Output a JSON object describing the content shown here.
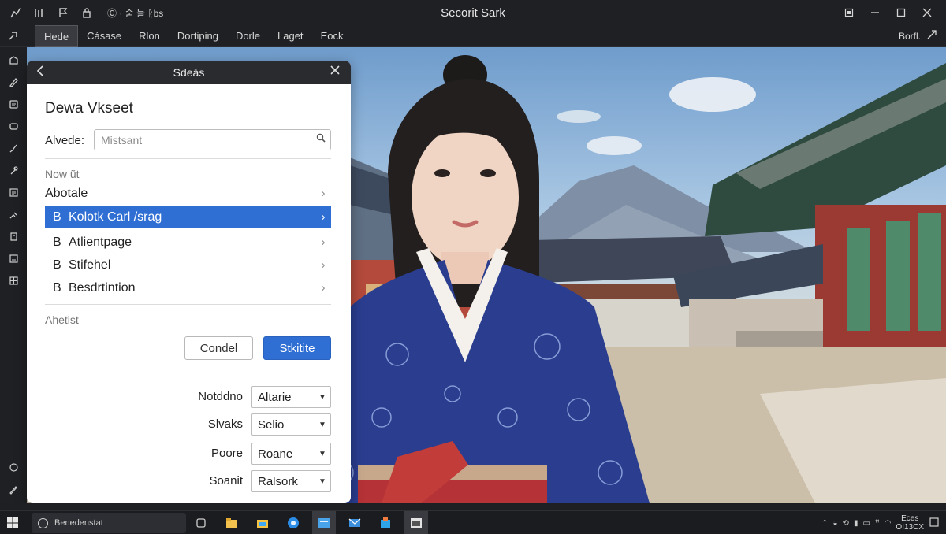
{
  "window": {
    "title": "Secorit Sark",
    "toolbar_text": "Ⓒ · 숟 들 ᚱbs",
    "controls": [
      "restore-small",
      "minimize",
      "maximize",
      "close"
    ]
  },
  "menubar": {
    "items": [
      {
        "label": "Hede",
        "active": true
      },
      {
        "label": "Cásase",
        "active": false
      },
      {
        "label": "Rlon",
        "active": false
      },
      {
        "label": "Dortiping",
        "active": false
      },
      {
        "label": "Dorle",
        "active": false
      },
      {
        "label": "Laget",
        "active": false
      },
      {
        "label": "Eock",
        "active": false
      }
    ],
    "right_label": "Borfl."
  },
  "panel": {
    "header_title": "Sdeăs",
    "title": "Dewa Vkseet",
    "search": {
      "label": "Alvede:",
      "placeholder": "Mistsant",
      "value": ""
    },
    "section1_label": "Now ũt",
    "list": [
      {
        "prefix": "",
        "label": "Abotale",
        "selected": false
      },
      {
        "prefix": "B",
        "label": "Kolotk Carl /srag",
        "selected": true
      },
      {
        "prefix": "B",
        "label": "Atlientpage",
        "selected": false
      },
      {
        "prefix": "B",
        "label": "Stifehel",
        "selected": false
      },
      {
        "prefix": "B",
        "label": "Besdrtintion",
        "selected": false
      }
    ],
    "section2_label": "Ahetist",
    "cancel_label": "Condel",
    "primary_label": "Stkitite",
    "fields": [
      {
        "label": "Notddno",
        "value": "Altarie"
      },
      {
        "label": "Slvaks",
        "value": "Selio"
      },
      {
        "label": "Poore",
        "value": "Roane"
      },
      {
        "label": "Soanit",
        "value": "Ralsork"
      }
    ]
  },
  "taskbar": {
    "search_text": "Benedenstat",
    "clock_line1": "Eces",
    "clock_line2": "OI13CX"
  },
  "colors": {
    "accent": "#2f6fd3",
    "chrome_bg": "#1f2023",
    "panel_bg": "#ffffff"
  }
}
